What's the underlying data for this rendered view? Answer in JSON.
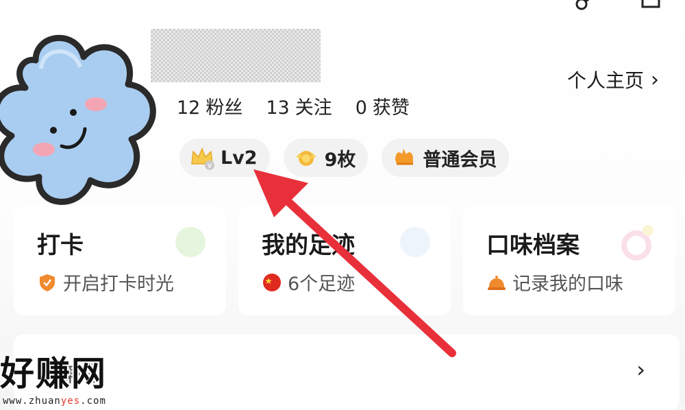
{
  "header": {
    "profile_link_label": "个人主页",
    "profile_link_chevron": "›"
  },
  "stats": [
    {
      "value": "12",
      "label": "粉丝"
    },
    {
      "value": "13",
      "label": "关注"
    },
    {
      "value": "0",
      "label": "获赞"
    }
  ],
  "badges": {
    "level": {
      "label": "Lv2",
      "icon": "level-crown-icon"
    },
    "coins": {
      "label": "9枚",
      "icon": "coin-medal-icon"
    },
    "membership": {
      "label": "普通会员",
      "icon": "member-hand-icon"
    }
  },
  "cards": [
    {
      "title": "打卡",
      "subtitle": "开启打卡时光",
      "icon": "checkin-shield-icon"
    },
    {
      "title": "我的足迹",
      "subtitle": "6个足迹",
      "icon": "china-flag-icon"
    },
    {
      "title": "口味档案",
      "subtitle": "记录我的口味",
      "icon": "dish-cover-icon"
    }
  ],
  "row": {
    "label": "课兼职",
    "chevron": "›"
  },
  "watermark": {
    "main": "好赚网",
    "url_prefix": "www.zhuan",
    "url_highlight": "yes",
    "url_suffix": ".com"
  },
  "colors": {
    "arrow": "#e8303a",
    "level_badge": "#f6c94c",
    "accent_orange": "#f39a2a"
  }
}
